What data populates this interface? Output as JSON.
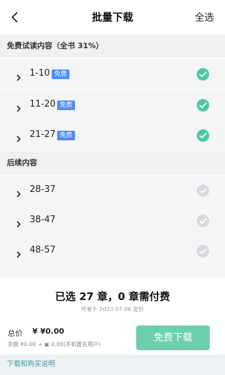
{
  "header": {
    "title": "批量下载",
    "select_all": "全选"
  },
  "free_section": {
    "title": "免费试读内容（全书 31%）",
    "items": [
      {
        "range": "1-10",
        "badge": "免费",
        "checked": true
      },
      {
        "range": "11-20",
        "badge": "免费",
        "checked": true
      },
      {
        "range": "21-27",
        "badge": "免费",
        "checked": true
      }
    ]
  },
  "paid_section": {
    "title": "后续内容",
    "items": [
      {
        "range": "28-37",
        "checked": false
      },
      {
        "range": "38-47",
        "checked": false
      },
      {
        "range": "48-57",
        "checked": false
      }
    ]
  },
  "bottom": {
    "summary": "已选 27 章，0 章需付费",
    "publish_info": "作者于 2023-07-06 定价",
    "total_label": "总价",
    "total_value": "¥ ¥0.00",
    "balance": "余额 ¥0.00 + ▣ 0.00(手机匿名用户)",
    "download_button": "免费下载",
    "help_link": "下载和购买说明"
  },
  "colors": {
    "accent": "#4cc7a5",
    "button": "#6dcfb0",
    "badge": "#4f8ef7",
    "link": "#3b9aa7"
  }
}
